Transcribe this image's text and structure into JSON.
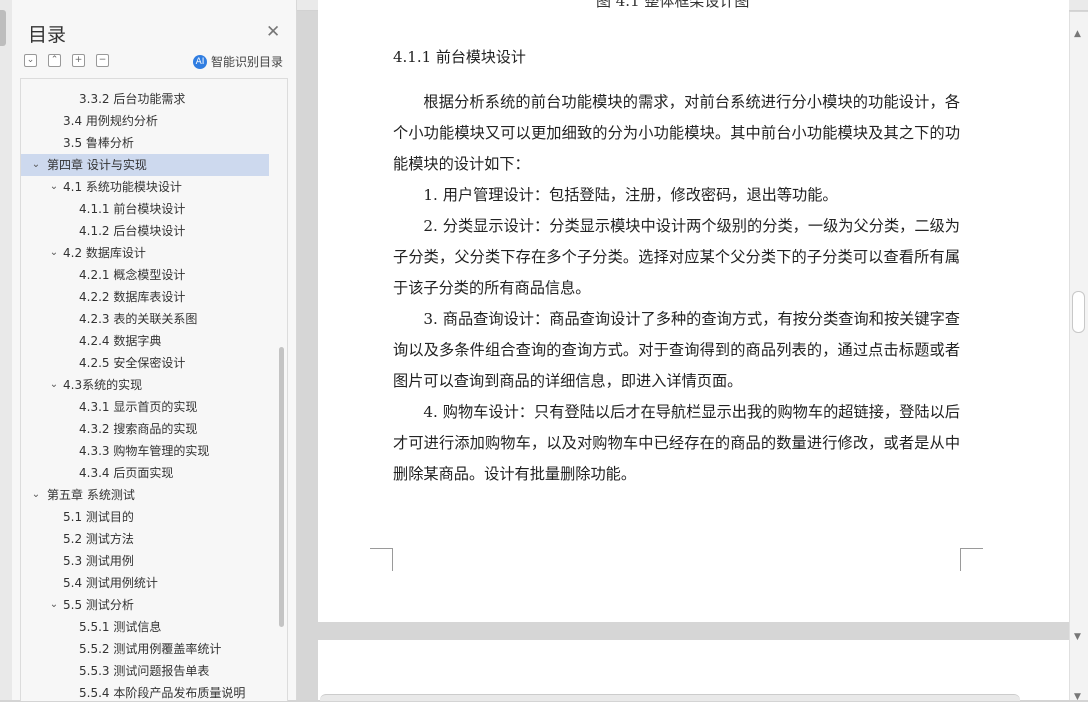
{
  "sidebar": {
    "title": "目录",
    "close_icon": "close-icon",
    "tools": [
      "collapse-all-icon",
      "level-up-icon",
      "expand-icon",
      "collapse-icon"
    ],
    "tool_glyphs": [
      "⌄",
      "⌃",
      "+",
      "−"
    ],
    "smart_label": "智能识别目录",
    "smart_icon_glyph": "AI",
    "items": [
      {
        "label": "3.3.2  后台功能需求",
        "level": 2,
        "caret": ""
      },
      {
        "label": "3.4  用例规约分析",
        "level": 1,
        "caret": ""
      },
      {
        "label": "3.5  鲁棒分析",
        "level": 1,
        "caret": ""
      },
      {
        "label": "第四章  设计与实现",
        "level": 0,
        "caret": "⌄",
        "selected": true
      },
      {
        "label": "4.1  系统功能模块设计",
        "level": 1,
        "caret": "⌄"
      },
      {
        "label": "4.1.1  前台模块设计",
        "level": 2,
        "caret": ""
      },
      {
        "label": "4.1.2  后台模块设计",
        "level": 2,
        "caret": ""
      },
      {
        "label": "4.2  数据库设计",
        "level": 1,
        "caret": "⌄"
      },
      {
        "label": "4.2.1  概念模型设计",
        "level": 2,
        "caret": ""
      },
      {
        "label": "4.2.2  数据库表设计",
        "level": 2,
        "caret": ""
      },
      {
        "label": "4.2.3  表的关联关系图",
        "level": 2,
        "caret": ""
      },
      {
        "label": "4.2.4  数据字典",
        "level": 2,
        "caret": ""
      },
      {
        "label": "4.2.5  安全保密设计",
        "level": 2,
        "caret": ""
      },
      {
        "label": "4.3系统的实现",
        "level": 1,
        "caret": "⌄"
      },
      {
        "label": "4.3.1  显示首页的实现",
        "level": 2,
        "caret": ""
      },
      {
        "label": "4.3.2  搜索商品的实现",
        "level": 2,
        "caret": ""
      },
      {
        "label": "4.3.3  购物车管理的实现",
        "level": 2,
        "caret": ""
      },
      {
        "label": "4.3.4  后页面实现",
        "level": 2,
        "caret": ""
      },
      {
        "label": "第五章  系统测试",
        "level": 0,
        "caret": "⌄"
      },
      {
        "label": "5.1  测试目的",
        "level": 1,
        "caret": ""
      },
      {
        "label": "5.2  测试方法",
        "level": 1,
        "caret": ""
      },
      {
        "label": "5.3  测试用例",
        "level": 1,
        "caret": ""
      },
      {
        "label": "5.4  测试用例统计",
        "level": 1,
        "caret": ""
      },
      {
        "label": "5.5  测试分析",
        "level": 1,
        "caret": "⌄"
      },
      {
        "label": "5.5.1  测试信息",
        "level": 2,
        "caret": ""
      },
      {
        "label": "5.5.2  测试用例覆盖率统计",
        "level": 2,
        "caret": ""
      },
      {
        "label": "5.5.3  测试问题报告单表",
        "level": 2,
        "caret": ""
      },
      {
        "label": "5.5.4  本阶段产品发布质量说明",
        "level": 2,
        "caret": ""
      }
    ]
  },
  "document": {
    "caption_partial": "图 4.1  整体框架设计图",
    "heading": "4.1.1  前台模块设计",
    "paragraphs": [
      "根据分析系统的前台功能模块的需求，对前台系统进行分小模块的功能设计，各个小功能模块又可以更加细致的分为小功能模块。其中前台小功能模块及其之下的功能模块的设计如下：",
      "1.   用户管理设计：包括登陆，注册，修改密码，退出等功能。",
      "2.   分类显示设计：分类显示模块中设计两个级别的分类，一级为父分类，二级为子分类，父分类下存在多个子分类。选择对应某个父分类下的子分类可以查看所有属于该子分类的所有商品信息。",
      "3.   商品查询设计：商品查询设计了多种的查询方式，有按分类查询和按关键字查询以及多条件组合查询的查询方式。对于查询得到的商品列表的，通过点击标题或者图片可以查询到商品的详细信息，即进入详情页面。",
      "4.   购物车设计：只有登陆以后才在导航栏显示出我的购物车的超链接，登陆以后才可进行添加购物车，以及对购物车中已经存在的商品的数量进行修改，或者是从中删除某商品。设计有批量删除功能。"
    ]
  },
  "scrollbar": {
    "up_glyph": "▲",
    "down_glyph": "▼"
  }
}
